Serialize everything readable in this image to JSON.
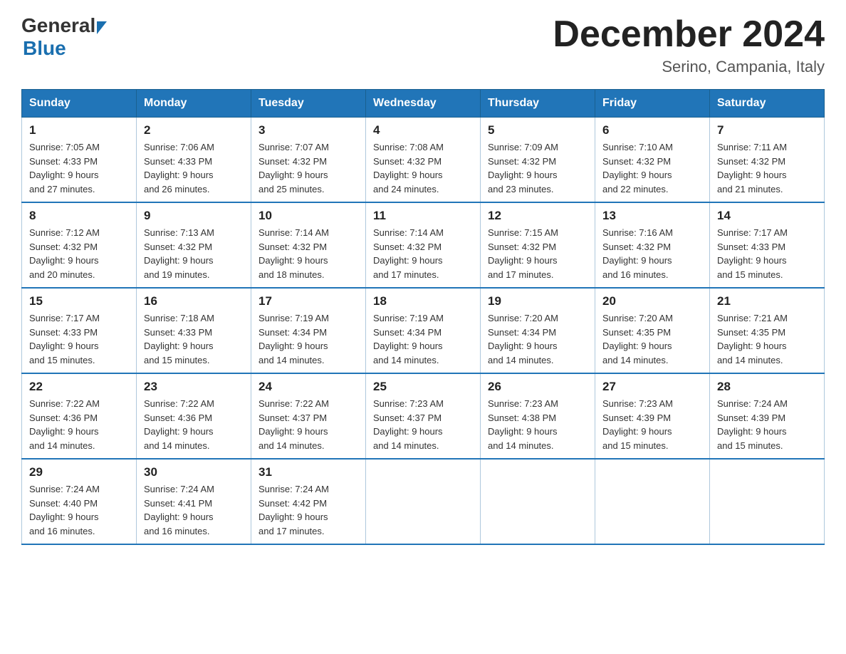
{
  "header": {
    "logo_general": "General",
    "logo_blue": "Blue",
    "month_title": "December 2024",
    "location": "Serino, Campania, Italy"
  },
  "days_of_week": [
    "Sunday",
    "Monday",
    "Tuesday",
    "Wednesday",
    "Thursday",
    "Friday",
    "Saturday"
  ],
  "weeks": [
    [
      {
        "day": "1",
        "sunrise": "7:05 AM",
        "sunset": "4:33 PM",
        "daylight": "9 hours and 27 minutes."
      },
      {
        "day": "2",
        "sunrise": "7:06 AM",
        "sunset": "4:33 PM",
        "daylight": "9 hours and 26 minutes."
      },
      {
        "day": "3",
        "sunrise": "7:07 AM",
        "sunset": "4:32 PM",
        "daylight": "9 hours and 25 minutes."
      },
      {
        "day": "4",
        "sunrise": "7:08 AM",
        "sunset": "4:32 PM",
        "daylight": "9 hours and 24 minutes."
      },
      {
        "day": "5",
        "sunrise": "7:09 AM",
        "sunset": "4:32 PM",
        "daylight": "9 hours and 23 minutes."
      },
      {
        "day": "6",
        "sunrise": "7:10 AM",
        "sunset": "4:32 PM",
        "daylight": "9 hours and 22 minutes."
      },
      {
        "day": "7",
        "sunrise": "7:11 AM",
        "sunset": "4:32 PM",
        "daylight": "9 hours and 21 minutes."
      }
    ],
    [
      {
        "day": "8",
        "sunrise": "7:12 AM",
        "sunset": "4:32 PM",
        "daylight": "9 hours and 20 minutes."
      },
      {
        "day": "9",
        "sunrise": "7:13 AM",
        "sunset": "4:32 PM",
        "daylight": "9 hours and 19 minutes."
      },
      {
        "day": "10",
        "sunrise": "7:14 AM",
        "sunset": "4:32 PM",
        "daylight": "9 hours and 18 minutes."
      },
      {
        "day": "11",
        "sunrise": "7:14 AM",
        "sunset": "4:32 PM",
        "daylight": "9 hours and 17 minutes."
      },
      {
        "day": "12",
        "sunrise": "7:15 AM",
        "sunset": "4:32 PM",
        "daylight": "9 hours and 17 minutes."
      },
      {
        "day": "13",
        "sunrise": "7:16 AM",
        "sunset": "4:32 PM",
        "daylight": "9 hours and 16 minutes."
      },
      {
        "day": "14",
        "sunrise": "7:17 AM",
        "sunset": "4:33 PM",
        "daylight": "9 hours and 15 minutes."
      }
    ],
    [
      {
        "day": "15",
        "sunrise": "7:17 AM",
        "sunset": "4:33 PM",
        "daylight": "9 hours and 15 minutes."
      },
      {
        "day": "16",
        "sunrise": "7:18 AM",
        "sunset": "4:33 PM",
        "daylight": "9 hours and 15 minutes."
      },
      {
        "day": "17",
        "sunrise": "7:19 AM",
        "sunset": "4:34 PM",
        "daylight": "9 hours and 14 minutes."
      },
      {
        "day": "18",
        "sunrise": "7:19 AM",
        "sunset": "4:34 PM",
        "daylight": "9 hours and 14 minutes."
      },
      {
        "day": "19",
        "sunrise": "7:20 AM",
        "sunset": "4:34 PM",
        "daylight": "9 hours and 14 minutes."
      },
      {
        "day": "20",
        "sunrise": "7:20 AM",
        "sunset": "4:35 PM",
        "daylight": "9 hours and 14 minutes."
      },
      {
        "day": "21",
        "sunrise": "7:21 AM",
        "sunset": "4:35 PM",
        "daylight": "9 hours and 14 minutes."
      }
    ],
    [
      {
        "day": "22",
        "sunrise": "7:22 AM",
        "sunset": "4:36 PM",
        "daylight": "9 hours and 14 minutes."
      },
      {
        "day": "23",
        "sunrise": "7:22 AM",
        "sunset": "4:36 PM",
        "daylight": "9 hours and 14 minutes."
      },
      {
        "day": "24",
        "sunrise": "7:22 AM",
        "sunset": "4:37 PM",
        "daylight": "9 hours and 14 minutes."
      },
      {
        "day": "25",
        "sunrise": "7:23 AM",
        "sunset": "4:37 PM",
        "daylight": "9 hours and 14 minutes."
      },
      {
        "day": "26",
        "sunrise": "7:23 AM",
        "sunset": "4:38 PM",
        "daylight": "9 hours and 14 minutes."
      },
      {
        "day": "27",
        "sunrise": "7:23 AM",
        "sunset": "4:39 PM",
        "daylight": "9 hours and 15 minutes."
      },
      {
        "day": "28",
        "sunrise": "7:24 AM",
        "sunset": "4:39 PM",
        "daylight": "9 hours and 15 minutes."
      }
    ],
    [
      {
        "day": "29",
        "sunrise": "7:24 AM",
        "sunset": "4:40 PM",
        "daylight": "9 hours and 16 minutes."
      },
      {
        "day": "30",
        "sunrise": "7:24 AM",
        "sunset": "4:41 PM",
        "daylight": "9 hours and 16 minutes."
      },
      {
        "day": "31",
        "sunrise": "7:24 AM",
        "sunset": "4:42 PM",
        "daylight": "9 hours and 17 minutes."
      },
      null,
      null,
      null,
      null
    ]
  ],
  "labels": {
    "sunrise": "Sunrise: ",
    "sunset": "Sunset: ",
    "daylight": "Daylight: "
  }
}
